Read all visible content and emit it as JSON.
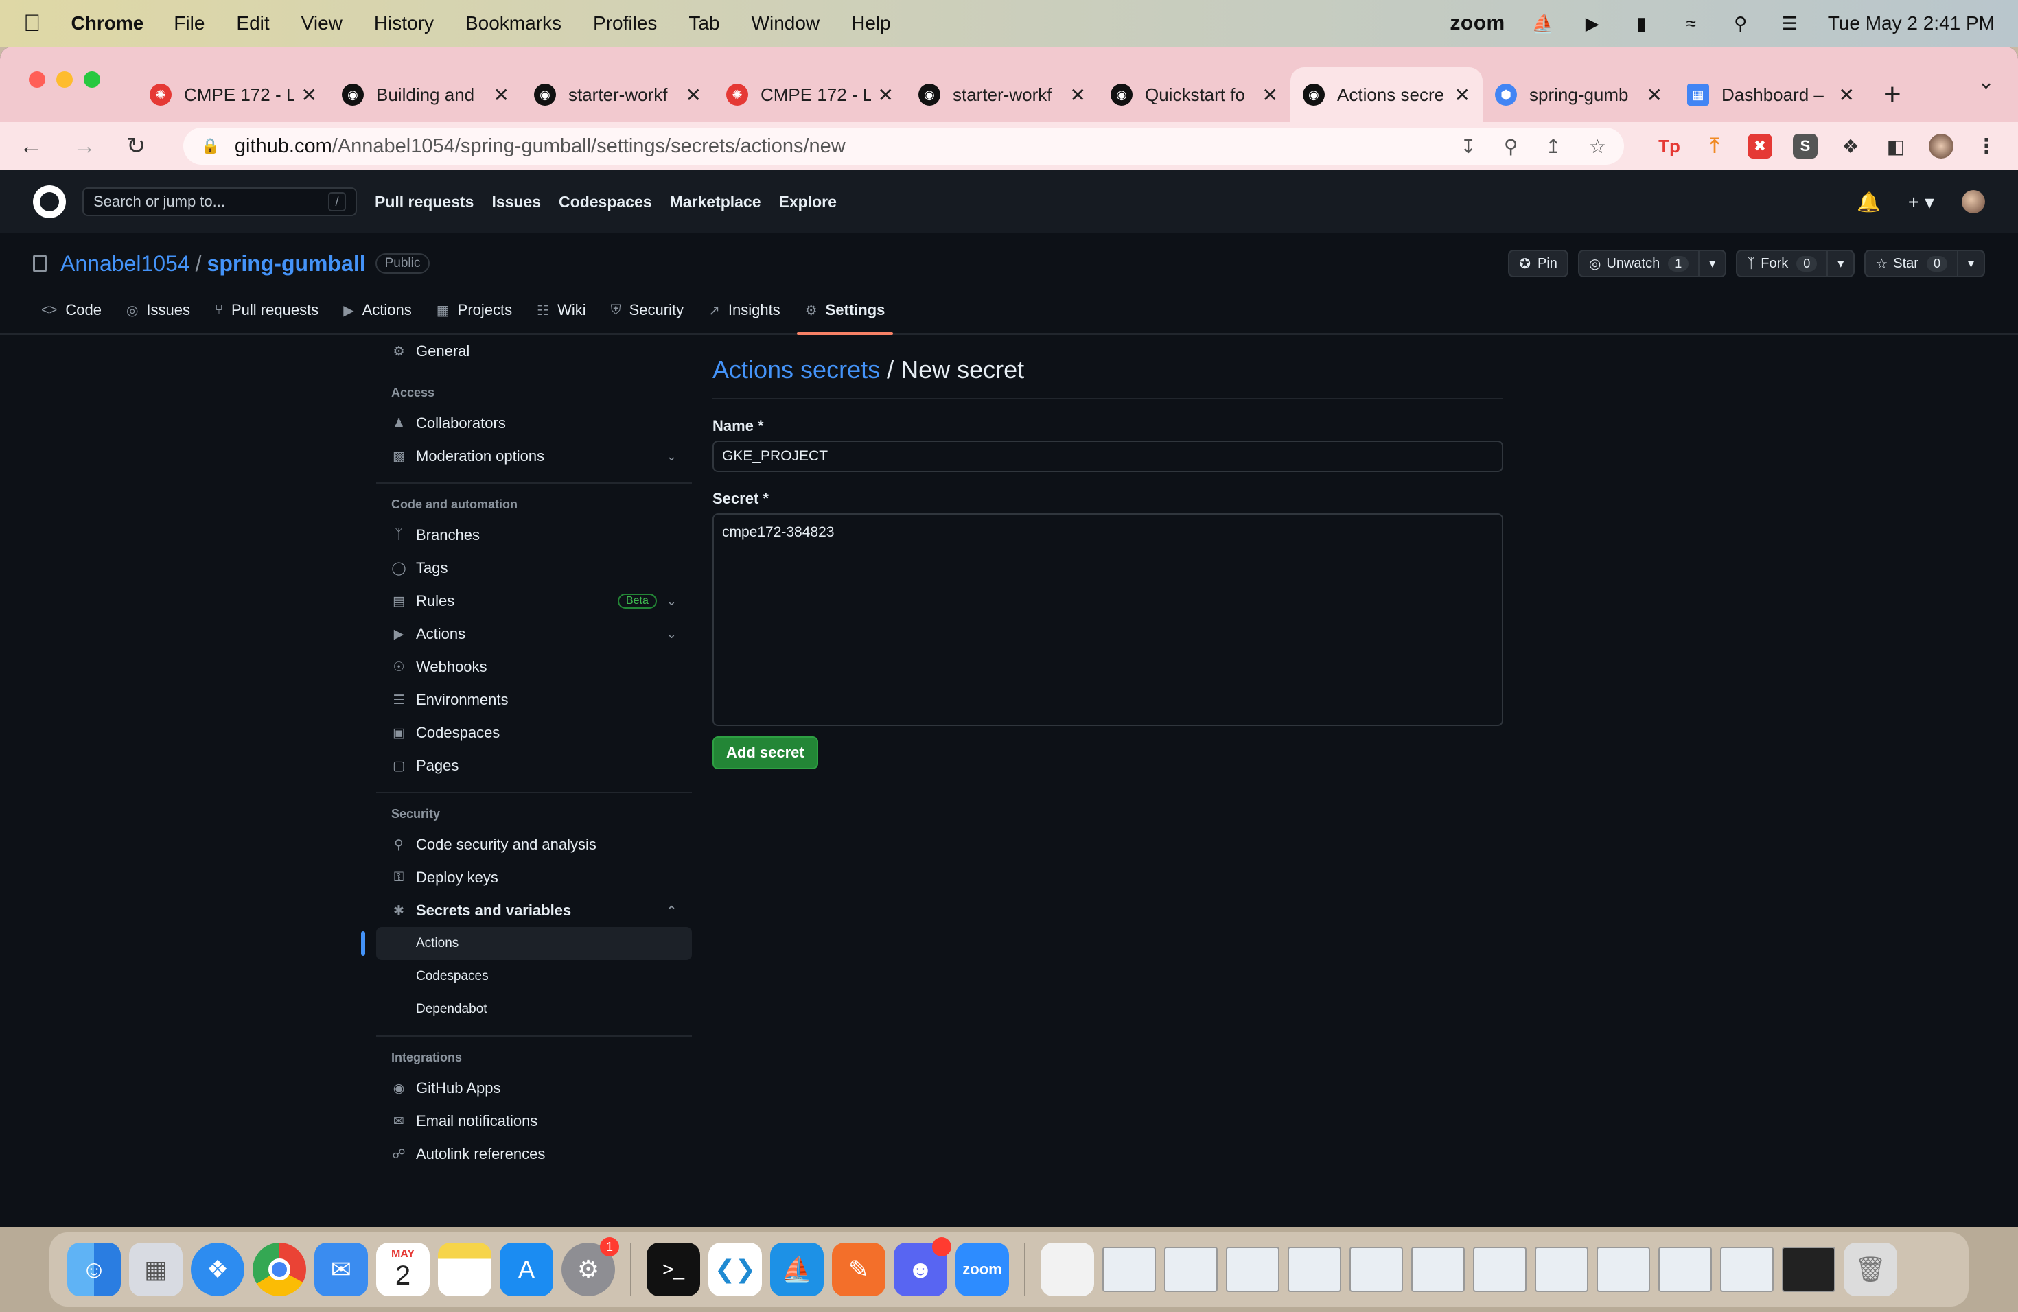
{
  "menubar": {
    "app": "Chrome",
    "items": [
      "File",
      "Edit",
      "View",
      "History",
      "Bookmarks",
      "Profiles",
      "Tab",
      "Window",
      "Help"
    ],
    "zoom": "zoom",
    "datetime": "Tue May 2  2:41 PM"
  },
  "tabs": [
    {
      "title": "CMPE 172 - L",
      "icon": "canvas-icon",
      "color": "#e53935"
    },
    {
      "title": "Building and",
      "icon": "github-icon",
      "color": "#111111"
    },
    {
      "title": "starter-workf",
      "icon": "github-icon",
      "color": "#111111"
    },
    {
      "title": "CMPE 172 - L",
      "icon": "canvas-icon",
      "color": "#e53935"
    },
    {
      "title": "starter-workf",
      "icon": "github-icon",
      "color": "#111111"
    },
    {
      "title": "Quickstart fo",
      "icon": "github-icon",
      "color": "#111111"
    },
    {
      "title": "Actions secre",
      "icon": "github-icon",
      "color": "#111111"
    },
    {
      "title": "spring-gumb",
      "icon": "gcp-icon",
      "color": "#4285f4"
    },
    {
      "title": "Dashboard –",
      "icon": "dashboard-icon",
      "color": "#4285f4"
    }
  ],
  "address": {
    "host": "github.com",
    "path": "/Annabel1054/spring-gumball/settings/secrets/actions/new"
  },
  "github": {
    "search_placeholder": "Search or jump to...",
    "search_key": "/",
    "nav": [
      "Pull requests",
      "Issues",
      "Codespaces",
      "Marketplace",
      "Explore"
    ]
  },
  "repo": {
    "owner": "Annabel1054",
    "name": "spring-gumball",
    "visibility": "Public",
    "pin": "Pin",
    "unwatch": "Unwatch",
    "unwatch_count": "1",
    "fork": "Fork",
    "fork_count": "0",
    "star": "Star",
    "star_count": "0"
  },
  "repotabs": [
    {
      "label": "Code",
      "icon": "<>"
    },
    {
      "label": "Issues",
      "icon": "◎"
    },
    {
      "label": "Pull requests",
      "icon": "⑂"
    },
    {
      "label": "Actions",
      "icon": "▶"
    },
    {
      "label": "Projects",
      "icon": "▦"
    },
    {
      "label": "Wiki",
      "icon": "☷"
    },
    {
      "label": "Security",
      "icon": "⛨"
    },
    {
      "label": "Insights",
      "icon": "↗"
    },
    {
      "label": "Settings",
      "icon": "⚙"
    }
  ],
  "sidebar": {
    "general": "General",
    "access_title": "Access",
    "collaborators": "Collaborators",
    "moderation": "Moderation options",
    "code_title": "Code and automation",
    "branches": "Branches",
    "tags": "Tags",
    "rules": "Rules",
    "beta": "Beta",
    "actions": "Actions",
    "webhooks": "Webhooks",
    "environments": "Environments",
    "codespaces": "Codespaces",
    "pages": "Pages",
    "security_title": "Security",
    "code_security": "Code security and analysis",
    "deploy_keys": "Deploy keys",
    "secrets_vars": "Secrets and variables",
    "sub_actions": "Actions",
    "sub_codespaces": "Codespaces",
    "sub_dependabot": "Dependabot",
    "integrations_title": "Integrations",
    "github_apps": "GitHub Apps",
    "email_notifications": "Email notifications",
    "autolink": "Autolink references"
  },
  "form": {
    "title_link": "Actions secrets",
    "title_rest": " / New secret",
    "name_label": "Name *",
    "name_value": "GKE_PROJECT",
    "secret_label": "Secret *",
    "secret_value": "cmpe172-384823",
    "submit": "Add secret"
  },
  "dock": {
    "calendar_month": "MAY",
    "calendar_day": "2",
    "settings_badge": "1",
    "zoom_label": "zoom"
  }
}
